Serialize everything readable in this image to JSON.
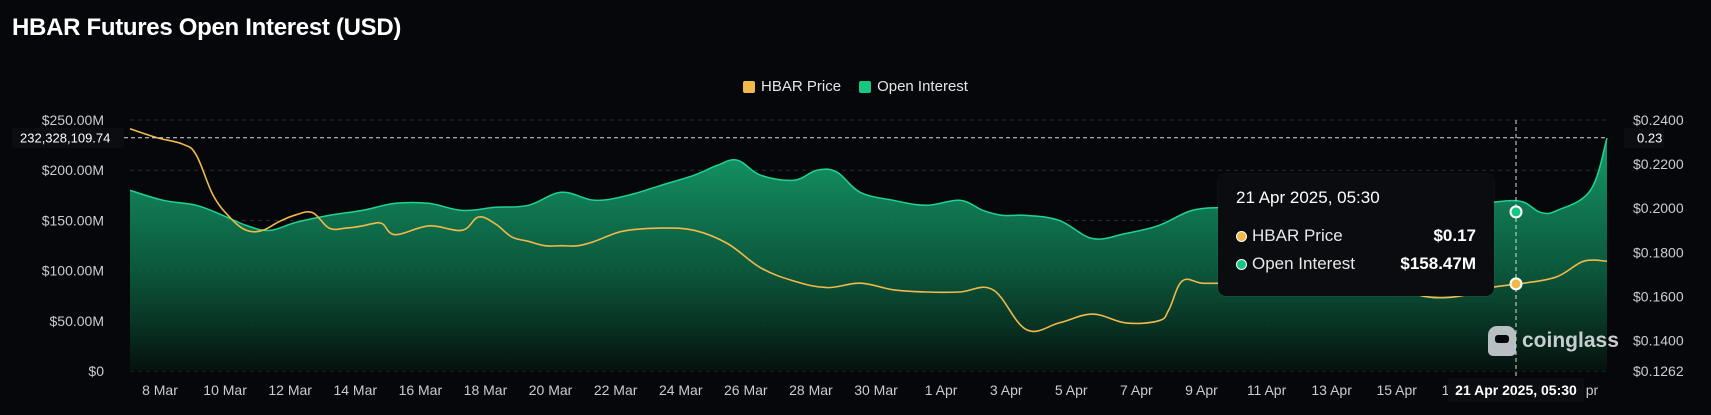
{
  "title": "HBAR Futures Open Interest (USD)",
  "legend": [
    {
      "name": "HBAR Price",
      "color": "#f0b94a"
    },
    {
      "name": "Open Interest",
      "color": "#16c784"
    }
  ],
  "crosshair": {
    "left_label": "232,328,109.74",
    "right_label": "0.23",
    "x_label": "21 Apr 2025, 05:30"
  },
  "tooltip": {
    "date": "21 Apr 2025, 05:30",
    "rows": [
      {
        "label": "HBAR Price",
        "value": "$0.17",
        "color": "#f0b94a"
      },
      {
        "label": "Open Interest",
        "value": "$158.47M",
        "color": "#16c784"
      }
    ]
  },
  "watermark": "coinglass",
  "chart_data": {
    "type": "area",
    "title": "HBAR Futures Open Interest (USD)",
    "x_ticks": [
      "8 Mar",
      "10 Mar",
      "12 Mar",
      "14 Mar",
      "16 Mar",
      "18 Mar",
      "20 Mar",
      "22 Mar",
      "24 Mar",
      "26 Mar",
      "28 Mar",
      "30 Mar",
      "1 Apr",
      "3 Apr",
      "5 Apr",
      "7 Apr",
      "9 Apr",
      "11 Apr",
      "13 Apr",
      "15 Apr",
      "17 Apr",
      "19",
      "pr"
    ],
    "y_left_ticks": [
      {
        "label": "$250.00M",
        "value": 250
      },
      {
        "label": "$200.00M",
        "value": 200
      },
      {
        "label": "$150.00M",
        "value": 150
      },
      {
        "label": "$100.00M",
        "value": 100
      },
      {
        "label": "$50.00M",
        "value": 50
      },
      {
        "label": "$0",
        "value": 0
      }
    ],
    "y_right_ticks": [
      {
        "label": "$0.2400",
        "value": 0.24
      },
      {
        "label": "$0.2200",
        "value": 0.22
      },
      {
        "label": "$0.2000",
        "value": 0.2
      },
      {
        "label": "$0.1800",
        "value": 0.18
      },
      {
        "label": "$0.1600",
        "value": 0.16
      },
      {
        "label": "$0.1400",
        "value": 0.14
      },
      {
        "label": "$0.1262",
        "value": 0.1262
      }
    ],
    "ylim_left": [
      0,
      250
    ],
    "ylim_right": [
      0.1262,
      0.24
    ],
    "x_range": [
      0,
      44.5
    ],
    "grid": true,
    "legend_position": "top-center",
    "series": [
      {
        "name": "Open Interest",
        "unit": "USD millions",
        "axis": "left",
        "color": "#16c784",
        "x": [
          0,
          1,
          2,
          2.8,
          3.5,
          4.2,
          5,
          6,
          7,
          8,
          9,
          10,
          11,
          12,
          13,
          14,
          15,
          16,
          17,
          17.7,
          18.3,
          19,
          20,
          20.7,
          21.3,
          22,
          23,
          24,
          25,
          25.7,
          26.3,
          27,
          28,
          29,
          30,
          31,
          32,
          33,
          34,
          34.7,
          35.3,
          36,
          37,
          38,
          39,
          40,
          41,
          41.9,
          42.5,
          43,
          44,
          44.5
        ],
        "values": [
          180,
          170,
          165,
          155,
          145,
          140,
          148,
          155,
          160,
          167,
          167,
          160,
          163,
          165,
          178,
          170,
          175,
          185,
          195,
          205,
          210,
          195,
          190,
          200,
          198,
          178,
          170,
          165,
          170,
          160,
          155,
          155,
          150,
          132,
          137,
          145,
          160,
          163,
          165,
          168,
          170,
          170,
          168,
          165,
          167,
          165,
          168,
          169,
          158,
          160,
          180,
          232
        ]
      },
      {
        "name": "HBAR Price",
        "unit": "USD",
        "axis": "right",
        "color": "#f0b94a",
        "x": [
          0,
          0.8,
          1.6,
          2,
          2.5,
          3,
          3.5,
          4,
          4.5,
          5,
          5.5,
          6,
          6.5,
          7,
          7.3,
          7.6,
          8,
          9,
          10,
          10.5,
          11,
          11.5,
          12,
          12.5,
          13,
          13.5,
          14,
          14.5,
          15,
          16,
          17,
          18,
          19,
          20,
          21,
          22,
          23,
          24,
          25,
          26,
          27,
          28,
          29,
          30,
          31,
          31.3,
          31.7,
          32.3,
          33,
          34,
          35,
          36,
          37,
          38,
          39,
          40,
          41,
          42,
          43,
          43.8,
          44.5
        ],
        "values": [
          0.236,
          0.232,
          0.229,
          0.224,
          0.206,
          0.196,
          0.19,
          0.19,
          0.194,
          0.197,
          0.198,
          0.191,
          0.191,
          0.192,
          0.193,
          0.193,
          0.188,
          0.192,
          0.19,
          0.196,
          0.193,
          0.187,
          0.185,
          0.183,
          0.183,
          0.183,
          0.185,
          0.188,
          0.19,
          0.191,
          0.19,
          0.184,
          0.173,
          0.167,
          0.164,
          0.166,
          0.163,
          0.162,
          0.162,
          0.163,
          0.145,
          0.148,
          0.152,
          0.148,
          0.149,
          0.154,
          0.167,
          0.166,
          0.166,
          0.166,
          0.165,
          0.165,
          0.165,
          0.165,
          0.16,
          0.16,
          0.164,
          0.166,
          0.169,
          0.176,
          0.176
        ]
      }
    ]
  }
}
